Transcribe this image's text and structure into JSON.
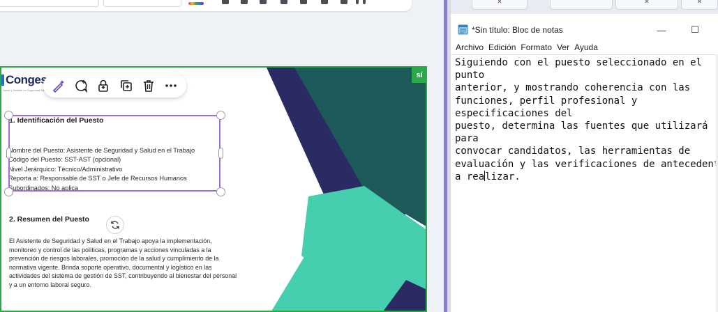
{
  "slide": {
    "logo_text": "Congese",
    "logo_subtext": "Salud y Gestión en Seguridad SAS",
    "badge": "sí",
    "section1_title": "1. Identificación del Puesto",
    "section1_lines": [
      "Nombre del Puesto: Asistente de Seguridad y Salud en el Trabajo",
      "Código del Puesto: SST-AST (opcional)",
      "Nivel Jerárquico: Técnico/Administrativo",
      "Reporta a: Responsable de SST o Jefe de Recursos Humanos",
      "Subordinados: No aplica"
    ],
    "section2_title": "2. Resumen del Puesto",
    "section2_lines": [
      "El Asistente de Seguridad y Salud en el Trabajo apoya la implementación,",
      "monitoreo y control de las políticas, programas y acciones vinculadas a la",
      "prevención de riesgos laborales, promoción de la salud y cumplimiento de la",
      "normativa vigente. Brinda soporte operativo, documental y logístico en las",
      "actividades del sistema de gestión de SST, contribuyendo al bienestar del personal",
      "y a un entorno laboral seguro."
    ],
    "colors": {
      "dark_navy": "#2b2b63",
      "teal_dark": "#1e5a5a",
      "teal_light": "#45cfae",
      "accent_green": "#2ba84a",
      "selection": "#9b6dd6"
    }
  },
  "float_toolbar": {
    "icons": [
      "magic-pen-icon",
      "comment-add-icon",
      "lock-icon",
      "duplicate-icon",
      "trash-icon",
      "more-icon"
    ]
  },
  "notepad": {
    "title": "*Sin título: Bloc de notas",
    "minimize": "—",
    "maximize": "☐",
    "menus": [
      "Archivo",
      "Edición",
      "Formato",
      "Ver",
      "Ayuda"
    ],
    "text_lines": [
      "Siguiendo con el puesto seleccionado en el",
      "punto",
      "anterior, y mostrando coherencia con las",
      "funciones, perfil profesional y",
      "especificaciones del",
      "puesto, determina las fuentes que utilizará",
      "para",
      "convocar candidatos, las herramientas de",
      "evaluación y las verificaciones de antecedentes"
    ],
    "last_line_before_caret": "a rea",
    "last_line_after_caret": "lizar."
  }
}
